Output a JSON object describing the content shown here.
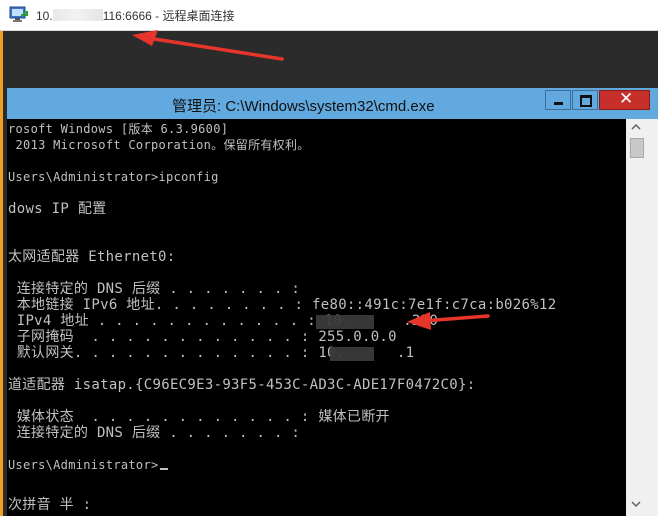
{
  "rdp": {
    "title_prefix": "10.",
    "title_suffix": "116:6666 - 远程桌面连接"
  },
  "cmd": {
    "title": "管理员: C:\\Windows\\system32\\cmd.exe",
    "lines": [
      "rosoft Windows [版本 6.3.9600]",
      " 2013 Microsoft Corporation。保留所有权利。",
      "",
      "Users\\Administrator>ipconfig",
      "",
      "dows IP 配置",
      "",
      "",
      "太网适配器 Ethernet0:",
      "",
      " 连接特定的 DNS 后缀 . . . . . . . :",
      " 本地链接 IPv6 地址. . . . . . . . : fe80::491c:7e1f:c7ca:b026%12",
      " IPv4 地址 . . . . . . . . . . . . : 10.      .220",
      " 子网掩码  . . . . . . . . . . . . : 255.0.0.0",
      " 默认网关. . . . . . . . . . . . . : 10.      .1",
      "",
      "道适配器 isatap.{C96EC9E3-93F5-453C-AD3C-ADE17F0472C0}:",
      "",
      " 媒体状态  . . . . . . . . . . . . : 媒体已断开",
      " 连接特定的 DNS 后缀 . . . . . . . :",
      "",
      "Users\\Administrator>",
      "",
      "次拼音 半 :"
    ]
  },
  "icons": {
    "rdp": "remote-desktop-icon",
    "minimize": "minimize-icon",
    "maximize": "maximize-icon",
    "close": "close-icon",
    "close_glyph": "✕",
    "scroll_up": "scroll-up-arrow-icon",
    "scroll_down": "scroll-down-arrow-icon"
  },
  "colors": {
    "annotation": "#e8352b",
    "cmd_title_bg": "#62a9df",
    "console_bg": "#000000",
    "console_text": "#c0c0c0",
    "close_button": "#c7302a"
  }
}
